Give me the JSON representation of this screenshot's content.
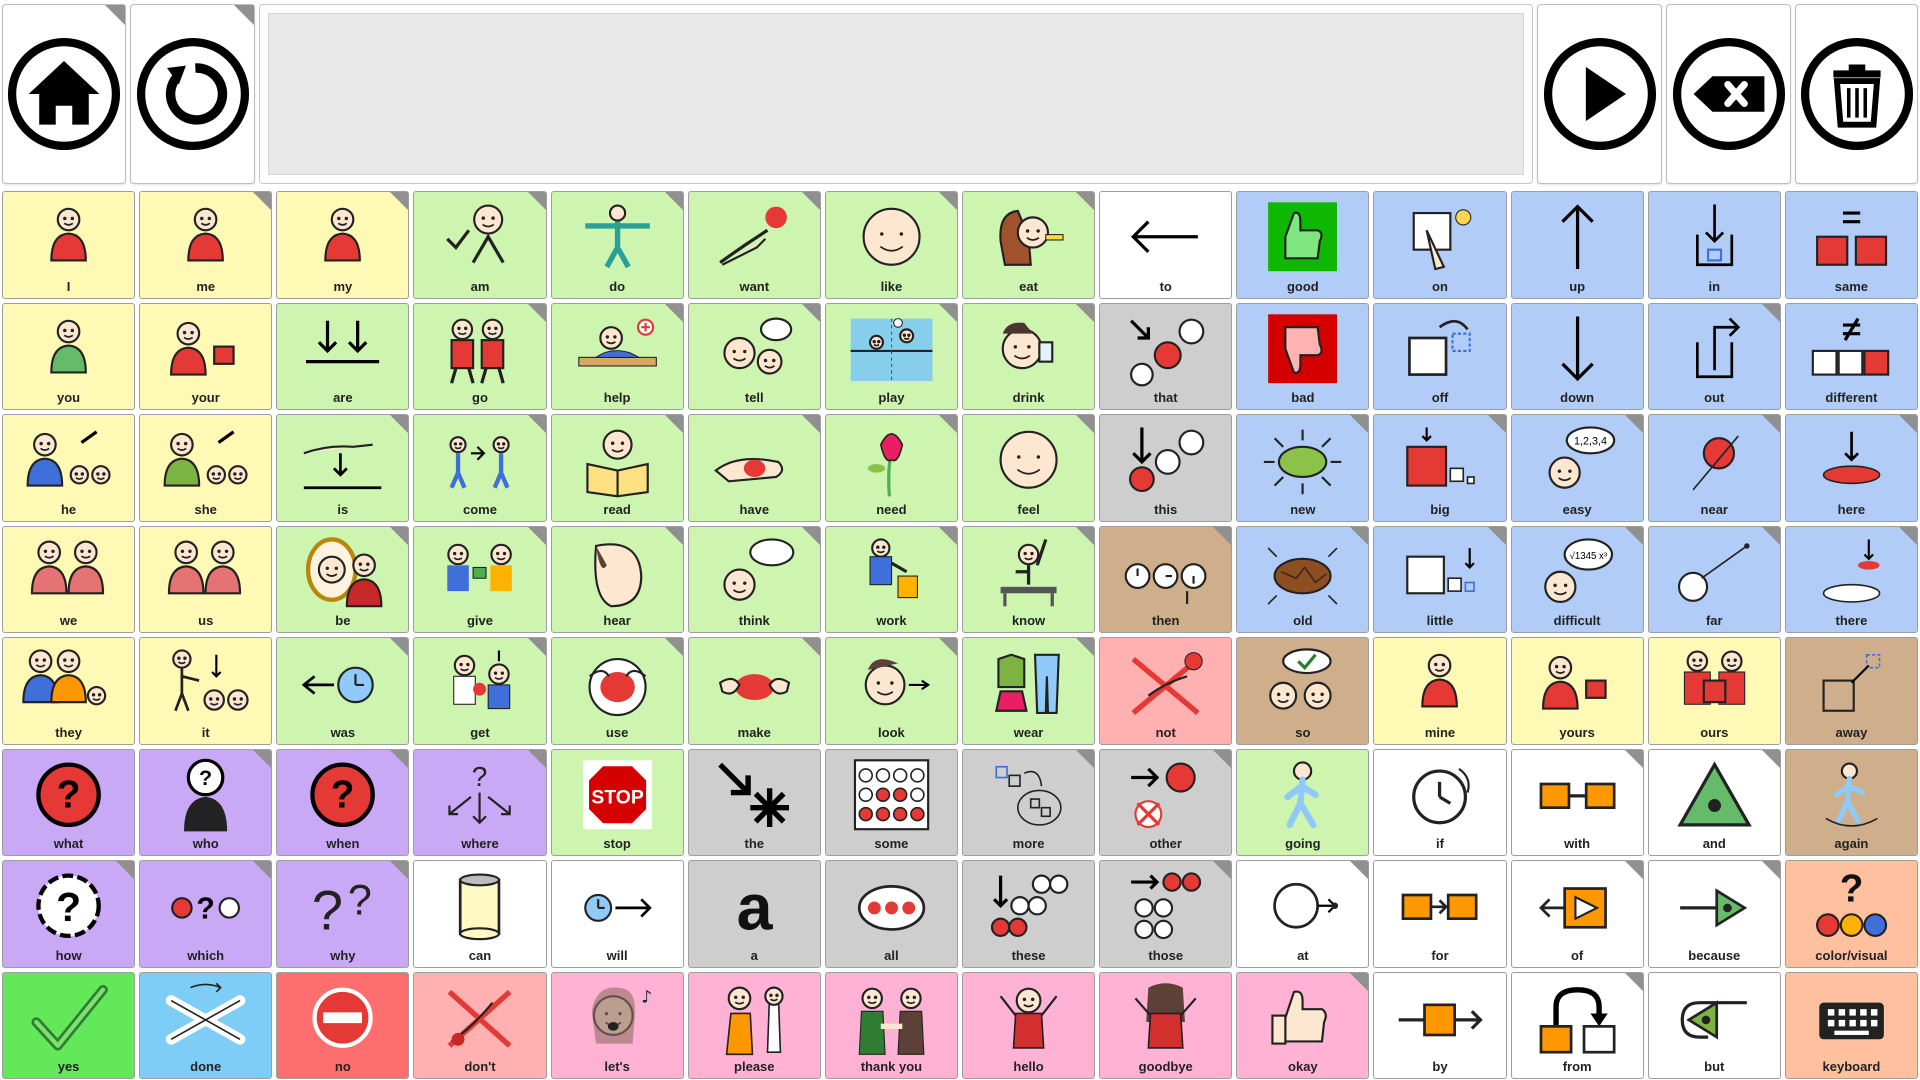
{
  "toolbar": {
    "home": {
      "icon": "home-icon"
    },
    "reset": {
      "icon": "rotate-icon"
    },
    "speak": {
      "icon": "play-icon"
    },
    "backspace": {
      "icon": "backspace-icon"
    },
    "clear": {
      "icon": "trash-icon"
    }
  },
  "message": {
    "text": ""
  },
  "colors": {
    "yellow": "#fef9b4",
    "green": "#cdf5b0",
    "white": "#ffffff",
    "blue": "#b1ccf6",
    "gray": "#cecece",
    "brown": "#cfae8b",
    "pink_red": "#ffb1b1",
    "purple": "#c9a9f5",
    "pink": "#ffb2d3",
    "salmon": "#ffc09f",
    "yes_green": "#63e85a",
    "done_blue": "#7ecdf6",
    "no_red": "#ff6e6e"
  },
  "grid": {
    "rows": [
      [
        {
          "label": "I",
          "color": "yellow",
          "icon": "person-self-icon",
          "folder": false
        },
        {
          "label": "me",
          "color": "yellow",
          "icon": "person-self-icon",
          "folder": true
        },
        {
          "label": "my",
          "color": "yellow",
          "icon": "person-self-icon",
          "folder": true
        },
        {
          "label": "am",
          "color": "green",
          "icon": "person-check-icon",
          "folder": true
        },
        {
          "label": "do",
          "color": "green",
          "icon": "person-arms-out-icon",
          "folder": true
        },
        {
          "label": "want",
          "color": "green",
          "icon": "hand-reach-icon",
          "folder": true
        },
        {
          "label": "like",
          "color": "green",
          "icon": "face-smile-icon",
          "folder": true
        },
        {
          "label": "eat",
          "color": "green",
          "icon": "eating-icon",
          "folder": true
        },
        {
          "label": "to",
          "color": "white",
          "icon": "arrow-left-icon",
          "folder": false
        },
        {
          "label": "good",
          "color": "blue",
          "icon": "thumbs-up-icon",
          "folder": false
        },
        {
          "label": "on",
          "color": "blue",
          "icon": "switch-on-icon",
          "folder": false
        },
        {
          "label": "up",
          "color": "blue",
          "icon": "arrow-up-icon",
          "folder": false
        },
        {
          "label": "in",
          "color": "blue",
          "icon": "arrow-into-box-icon",
          "folder": false
        },
        {
          "label": "same",
          "color": "blue",
          "icon": "equal-boxes-icon",
          "folder": false
        }
      ],
      [
        {
          "label": "you",
          "color": "yellow",
          "icon": "person-icon",
          "folder": false
        },
        {
          "label": "your",
          "color": "yellow",
          "icon": "person-give-icon",
          "folder": false
        },
        {
          "label": "are",
          "color": "green",
          "icon": "arrows-down-line-icon",
          "folder": false
        },
        {
          "label": "go",
          "color": "green",
          "icon": "people-walking-icon",
          "folder": true
        },
        {
          "label": "help",
          "color": "green",
          "icon": "help-person-icon",
          "folder": true
        },
        {
          "label": "tell",
          "color": "green",
          "icon": "talking-people-icon",
          "folder": true
        },
        {
          "label": "play",
          "color": "green",
          "icon": "volleyball-icon",
          "folder": true
        },
        {
          "label": "drink",
          "color": "green",
          "icon": "drinking-icon",
          "folder": true
        },
        {
          "label": "that",
          "color": "gray",
          "icon": "pointer-circle-icon",
          "folder": false
        },
        {
          "label": "bad",
          "color": "blue",
          "icon": "thumbs-down-icon",
          "folder": false
        },
        {
          "label": "off",
          "color": "blue",
          "icon": "box-off-icon",
          "folder": false
        },
        {
          "label": "down",
          "color": "blue",
          "icon": "arrow-down-icon",
          "folder": false
        },
        {
          "label": "out",
          "color": "blue",
          "icon": "arrow-out-box-icon",
          "folder": true
        },
        {
          "label": "different",
          "color": "blue",
          "icon": "not-equal-boxes-icon",
          "folder": false
        }
      ],
      [
        {
          "label": "he",
          "color": "yellow",
          "icon": "boy-point-icon",
          "folder": false
        },
        {
          "label": "she",
          "color": "yellow",
          "icon": "girl-point-icon",
          "folder": false
        },
        {
          "label": "is",
          "color": "green",
          "icon": "hand-line-icon",
          "folder": true
        },
        {
          "label": "come",
          "color": "green",
          "icon": "people-meeting-icon",
          "folder": true
        },
        {
          "label": "read",
          "color": "green",
          "icon": "reading-icon",
          "folder": true
        },
        {
          "label": "have",
          "color": "green",
          "icon": "hand-holding-icon",
          "folder": true
        },
        {
          "label": "need",
          "color": "green",
          "icon": "flower-icon",
          "folder": true
        },
        {
          "label": "feel",
          "color": "green",
          "icon": "face-neutral-icon",
          "folder": true
        },
        {
          "label": "this",
          "color": "gray",
          "icon": "pointer-down-icon",
          "folder": false
        },
        {
          "label": "new",
          "color": "blue",
          "icon": "shining-oval-icon",
          "folder": true
        },
        {
          "label": "big",
          "color": "blue",
          "icon": "big-square-icon",
          "folder": true
        },
        {
          "label": "easy",
          "color": "blue",
          "icon": "thinking-numbers-icon",
          "folder": true
        },
        {
          "label": "near",
          "color": "blue",
          "icon": "near-ball-icon",
          "folder": true
        },
        {
          "label": "here",
          "color": "blue",
          "icon": "here-spot-icon",
          "folder": true
        }
      ],
      [
        {
          "label": "we",
          "color": "yellow",
          "icon": "two-people-icon",
          "folder": false
        },
        {
          "label": "us",
          "color": "yellow",
          "icon": "two-people-icon",
          "folder": false
        },
        {
          "label": "be",
          "color": "green",
          "icon": "mirror-icon",
          "folder": true
        },
        {
          "label": "give",
          "color": "green",
          "icon": "giving-icon",
          "folder": true
        },
        {
          "label": "hear",
          "color": "green",
          "icon": "ear-listen-icon",
          "folder": true
        },
        {
          "label": "think",
          "color": "green",
          "icon": "thought-bubble-icon",
          "folder": true
        },
        {
          "label": "work",
          "color": "green",
          "icon": "worker-icon",
          "folder": true
        },
        {
          "label": "know",
          "color": "green",
          "icon": "raise-hand-icon",
          "folder": true
        },
        {
          "label": "then",
          "color": "brown",
          "icon": "clocks-icon",
          "folder": true
        },
        {
          "label": "old",
          "color": "blue",
          "icon": "cracked-oval-icon",
          "folder": true
        },
        {
          "label": "little",
          "color": "blue",
          "icon": "little-square-icon",
          "folder": true
        },
        {
          "label": "difficult",
          "color": "blue",
          "icon": "thinking-math-icon",
          "folder": true
        },
        {
          "label": "far",
          "color": "blue",
          "icon": "far-ball-icon",
          "folder": true
        },
        {
          "label": "there",
          "color": "blue",
          "icon": "there-spot-icon",
          "folder": true
        }
      ],
      [
        {
          "label": "they",
          "color": "yellow",
          "icon": "group-icon",
          "folder": false
        },
        {
          "label": "it",
          "color": "yellow",
          "icon": "person-point-it-icon",
          "folder": false
        },
        {
          "label": "was",
          "color": "green",
          "icon": "clock-back-icon",
          "folder": true
        },
        {
          "label": "get",
          "color": "green",
          "icon": "getting-icon",
          "folder": true
        },
        {
          "label": "use",
          "color": "green",
          "icon": "hands-ball-icon",
          "folder": true
        },
        {
          "label": "make",
          "color": "green",
          "icon": "hands-clay-icon",
          "folder": true
        },
        {
          "label": "look",
          "color": "green",
          "icon": "looking-icon",
          "folder": true
        },
        {
          "label": "wear",
          "color": "green",
          "icon": "clothes-icon",
          "folder": true
        },
        {
          "label": "not",
          "color": "pink_red",
          "icon": "cross-hand-icon",
          "folder": false
        },
        {
          "label": "so",
          "color": "brown",
          "icon": "so-faces-icon",
          "folder": false
        },
        {
          "label": "mine",
          "color": "yellow",
          "icon": "person-self-icon",
          "folder": false
        },
        {
          "label": "yours",
          "color": "yellow",
          "icon": "person-give-icon",
          "folder": false
        },
        {
          "label": "ours",
          "color": "yellow",
          "icon": "two-people-box-icon",
          "folder": false
        },
        {
          "label": "away",
          "color": "brown",
          "icon": "away-box-icon",
          "folder": false
        }
      ],
      [
        {
          "label": "what",
          "color": "purple",
          "icon": "question-red-icon",
          "folder": false
        },
        {
          "label": "who",
          "color": "purple",
          "icon": "question-person-icon",
          "folder": true
        },
        {
          "label": "when",
          "color": "purple",
          "icon": "question-clock-icon",
          "folder": true
        },
        {
          "label": "where",
          "color": "purple",
          "icon": "question-arrows-icon",
          "folder": true
        },
        {
          "label": "stop",
          "color": "green",
          "icon": "stop-sign-icon",
          "folder": false
        },
        {
          "label": "the",
          "color": "gray",
          "icon": "arrow-star-icon",
          "folder": false
        },
        {
          "label": "some",
          "color": "gray",
          "icon": "some-circles-icon",
          "folder": false
        },
        {
          "label": "more",
          "color": "gray",
          "icon": "more-squares-icon",
          "folder": true
        },
        {
          "label": "other",
          "color": "gray",
          "icon": "other-circle-icon",
          "folder": true
        },
        {
          "label": "going",
          "color": "green",
          "icon": "walking-person-icon",
          "folder": false
        },
        {
          "label": "if",
          "color": "white",
          "icon": "if-clock-icon",
          "folder": false
        },
        {
          "label": "with",
          "color": "white",
          "icon": "linked-boxes-icon",
          "folder": true
        },
        {
          "label": "and",
          "color": "white",
          "icon": "green-triangle-icon",
          "folder": true
        },
        {
          "label": "again",
          "color": "brown",
          "icon": "again-person-icon",
          "folder": false
        }
      ],
      [
        {
          "label": "how",
          "color": "purple",
          "icon": "question-dashed-icon",
          "folder": true
        },
        {
          "label": "which",
          "color": "purple",
          "icon": "which-circles-icon",
          "folder": true
        },
        {
          "label": "why",
          "color": "purple",
          "icon": "two-question-icon",
          "folder": true
        },
        {
          "label": "can",
          "color": "white",
          "icon": "tin-can-icon",
          "folder": false
        },
        {
          "label": "will",
          "color": "white",
          "icon": "clock-forward-icon",
          "folder": false
        },
        {
          "label": "a",
          "color": "gray",
          "icon": "letter-a-icon",
          "folder": false
        },
        {
          "label": "all",
          "color": "gray",
          "icon": "all-dots-icon",
          "folder": false
        },
        {
          "label": "these",
          "color": "gray",
          "icon": "these-circles-icon",
          "folder": false
        },
        {
          "label": "those",
          "color": "gray",
          "icon": "those-circles-icon",
          "folder": true
        },
        {
          "label": "at",
          "color": "white",
          "icon": "at-head-icon",
          "folder": true
        },
        {
          "label": "for",
          "color": "white",
          "icon": "for-boxes-icon",
          "folder": false
        },
        {
          "label": "of",
          "color": "white",
          "icon": "of-arrow-icon",
          "folder": true
        },
        {
          "label": "because",
          "color": "white",
          "icon": "because-arrow-icon",
          "folder": true
        },
        {
          "label": "color/visual",
          "color": "salmon",
          "icon": "color-circles-icon",
          "folder": false
        }
      ],
      [
        {
          "label": "yes",
          "color": "yes_green",
          "icon": "checkmark-icon",
          "folder": false
        },
        {
          "label": "done",
          "color": "done_blue",
          "icon": "crossed-arms-icon",
          "folder": false
        },
        {
          "label": "no",
          "color": "no_red",
          "icon": "no-entry-icon",
          "folder": false
        },
        {
          "label": "don't",
          "color": "pink_red",
          "icon": "dont-cross-icon",
          "folder": false
        },
        {
          "label": "let's",
          "color": "pink",
          "icon": "singing-girl-icon",
          "folder": false
        },
        {
          "label": "please",
          "color": "pink",
          "icon": "please-people-icon",
          "folder": false
        },
        {
          "label": "thank you",
          "color": "pink",
          "icon": "handshake-icon",
          "folder": false
        },
        {
          "label": "hello",
          "color": "pink",
          "icon": "waving-girl-icon",
          "folder": false
        },
        {
          "label": "goodbye",
          "color": "pink",
          "icon": "goodbye-girl-icon",
          "folder": false
        },
        {
          "label": "okay",
          "color": "pink",
          "icon": "okay-thumb-icon",
          "folder": true
        },
        {
          "label": "by",
          "color": "white",
          "icon": "by-arrow-box-icon",
          "folder": false
        },
        {
          "label": "from",
          "color": "white",
          "icon": "from-box-icon",
          "folder": true
        },
        {
          "label": "but",
          "color": "white",
          "icon": "but-triangle-icon",
          "folder": false
        },
        {
          "label": "keyboard",
          "color": "salmon",
          "icon": "keyboard-icon",
          "folder": false
        }
      ]
    ]
  }
}
